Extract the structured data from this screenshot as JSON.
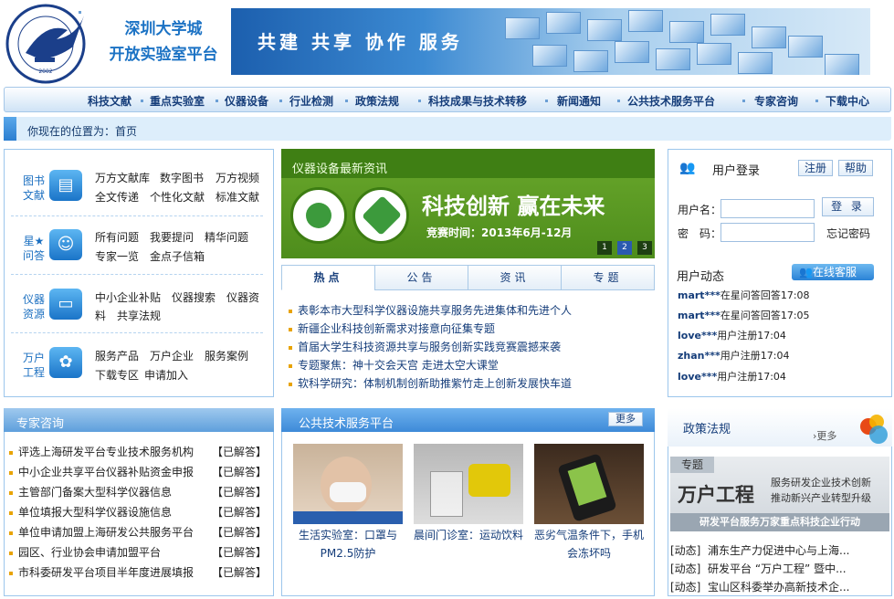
{
  "header": {
    "logo_text": "UNIVERSITY TOWN OF SHENZHEN",
    "site_name_line1": "深圳大学城",
    "site_name_line2": "开放实验室平台",
    "slogan": "共建 共享 协作 服务"
  },
  "nav": {
    "items": [
      "科技文献",
      "重点实验室",
      "仪器设备",
      "行业检测",
      "政策法规",
      "科技成果与技术转移",
      "新闻通知",
      "公共技术服务平台",
      "专家咨询",
      "下载中心"
    ]
  },
  "breadcrumb": {
    "prefix": "你现在的位置为：",
    "current": "首页"
  },
  "categories": [
    {
      "label": "图书\n文献",
      "icon": "document-icon",
      "links": [
        "万方文献库",
        "数字图书",
        "万方视频",
        "全文传递",
        "个性化文献",
        "标准文献"
      ]
    },
    {
      "label": "星★\n问答",
      "icon": "people-icon",
      "links": [
        "所有问题",
        "我要提问",
        "精华问题",
        "专家一览",
        "金点子信箱"
      ]
    },
    {
      "label": "仪器\n资源",
      "icon": "monitor-icon",
      "links": [
        "中小企业补贴",
        "仪器搜索",
        "仪器资",
        "料",
        "共享法规"
      ]
    },
    {
      "label": "万户\n工程",
      "icon": "gear-icon",
      "links": [
        "服务产品",
        "万户企业",
        "服务案例",
        "下载专区",
        "申请加入"
      ]
    }
  ],
  "green_banner": {
    "title": "仪器设备最新资讯",
    "slogan": "科技创新 赢在未来",
    "date": "竞赛时间：2013年6月-12月",
    "pages": [
      "1",
      "2",
      "3"
    ]
  },
  "tabs": [
    "热点",
    "公告",
    "资讯",
    "专题"
  ],
  "news": [
    "表彰本市大型科学仪器设施共享服务先进集体和先进个人",
    "新疆企业科技创新需求对接意向征集专题",
    "首届大学生科技资源共享与服务创新实践竞赛震撼来袭",
    "专题聚焦：神十交会天宫 走进太空大课堂",
    "软科学研究：体制机制创新助推紫竹走上创新发展快车道"
  ],
  "login": {
    "title": "用户登录",
    "register": "注册",
    "help": "帮助",
    "username_label": "用户名：",
    "password_label": "密　码：",
    "login_button": "登 录",
    "forgot": "忘记密码",
    "activity_title": "用户动态",
    "online_service": "在线客服",
    "activities": [
      {
        "user": "mart***",
        "text": "在星问答回答17:08"
      },
      {
        "user": "mart***",
        "text": "在星问答回答17:05"
      },
      {
        "user": "love***",
        "text": "用户注册17:04"
      },
      {
        "user": "zhan***",
        "text": "用户注册17:04"
      },
      {
        "user": "love***",
        "text": "用户注册17:04"
      }
    ]
  },
  "expert": {
    "title": "专家咨询",
    "questions": [
      "评选上海研发平台专业技术服务机构",
      "中小企业共享平台仪器补贴资金申报",
      "主管部门备案大型科学仪器信息",
      "单位填报大型科学仪器设施信息",
      "单位申请加盟上海研发公共服务平台",
      "园区、行业协会申请加盟平台",
      "市科委研发平台项目半年度进展填报"
    ],
    "answered": "【已解答】"
  },
  "platform": {
    "title": "公共技术服务平台",
    "more": "更多",
    "items": [
      {
        "caption1": "生活实验室：口罩与",
        "caption2": "PM2.5防护"
      },
      {
        "caption1": "晨间门诊室：运动饮料",
        "caption2": ""
      },
      {
        "caption1": "恶劣气温条件下，手机",
        "caption2": "会冻坏吗"
      }
    ]
  },
  "policy": {
    "title": "政策法规",
    "more": "更多",
    "special_label": "专题",
    "special_name": "万户工程",
    "special_desc1": "服务研发企业技术创新",
    "special_desc2": "推动新兴产业转型升级",
    "special_bottom": "研发平台服务万家重点科技企业行动",
    "items": [
      {
        "tag": "[动态]",
        "text": "浦东生产力促进中心与上海..."
      },
      {
        "tag": "[动态]",
        "text": "研发平台 “万户工程” 暨中..."
      },
      {
        "tag": "[动态]",
        "text": "宝山区科委举办高新技术企..."
      }
    ]
  }
}
